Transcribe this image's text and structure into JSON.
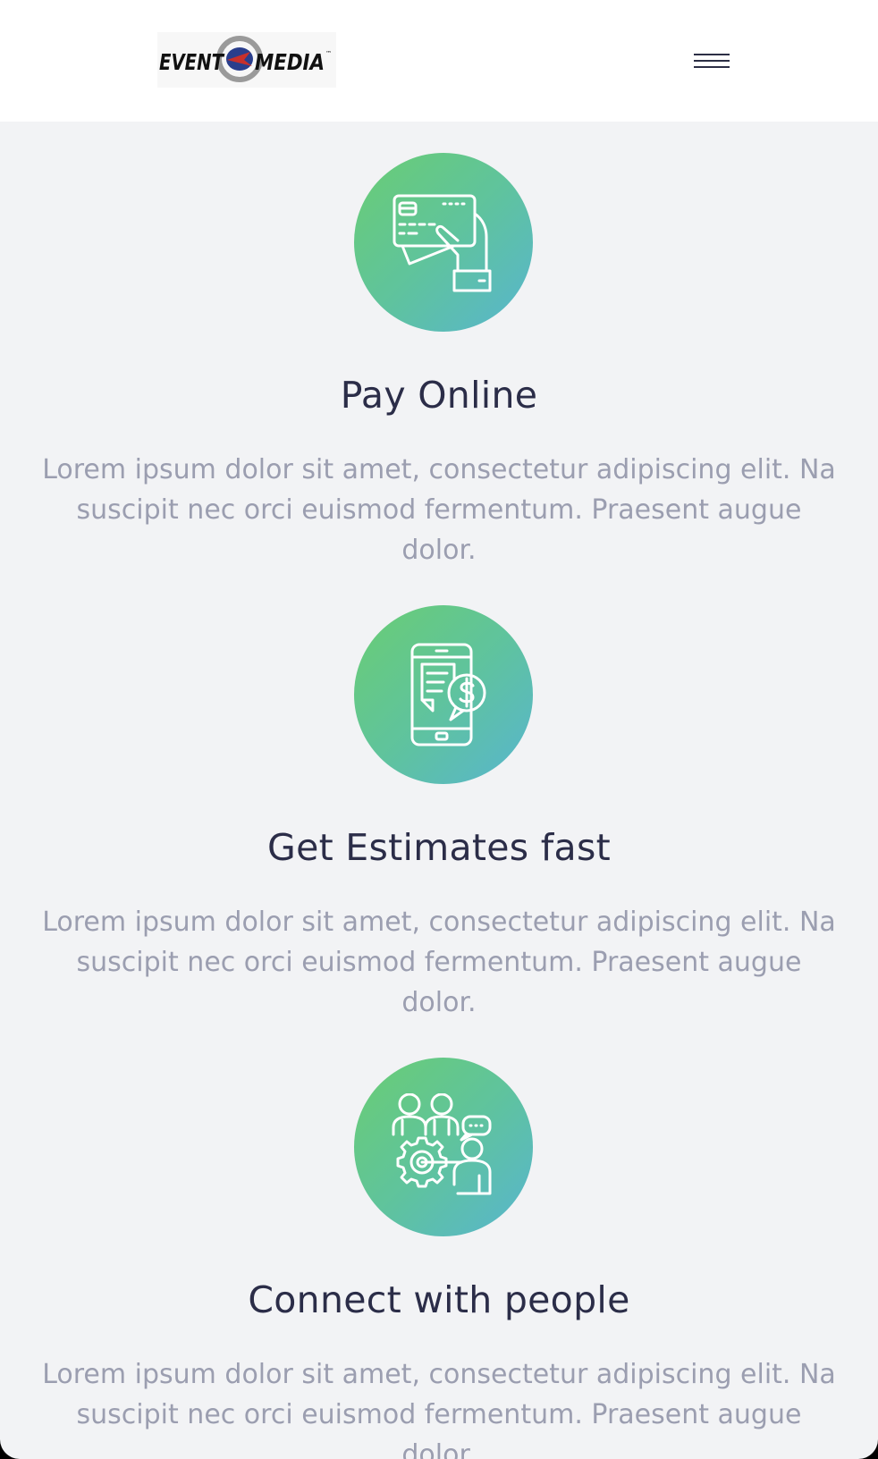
{
  "header": {
    "logo": {
      "text_left": "EVENT",
      "text_right": "MEDIA",
      "trademark": "™"
    },
    "menu_icon": "hamburger-menu-icon"
  },
  "features": [
    {
      "icon": "hand-credit-card-icon",
      "title": "Pay Online",
      "description": "Lorem ipsum dolor sit amet, consectetur adipiscing elit. Na suscipit nec orci euismod fermentum. Praesent augue dolor."
    },
    {
      "icon": "phone-invoice-dollar-icon",
      "title": "Get Estimates fast",
      "description": "Lorem ipsum dolor sit amet, consectetur adipiscing elit. Na suscipit nec orci euismod fermentum. Praesent augue dolor."
    },
    {
      "icon": "team-gear-chat-icon",
      "title": "Connect with people",
      "description": "Lorem ipsum dolor sit amet, consectetur adipiscing elit. Na suscipit nec orci euismod fermentum. Praesent augue dolor."
    }
  ],
  "colors": {
    "page_background": "#f2f3f5",
    "header_background": "#ffffff",
    "title_text": "#2b2d48",
    "body_text": "#9b9eb0",
    "icon_gradient_start": "#6acd73",
    "icon_gradient_end": "#58b5cf",
    "logo_ring": "#9a9a9a",
    "logo_swoosh_red": "#c8302b",
    "logo_swoosh_blue": "#2a3e8c"
  }
}
